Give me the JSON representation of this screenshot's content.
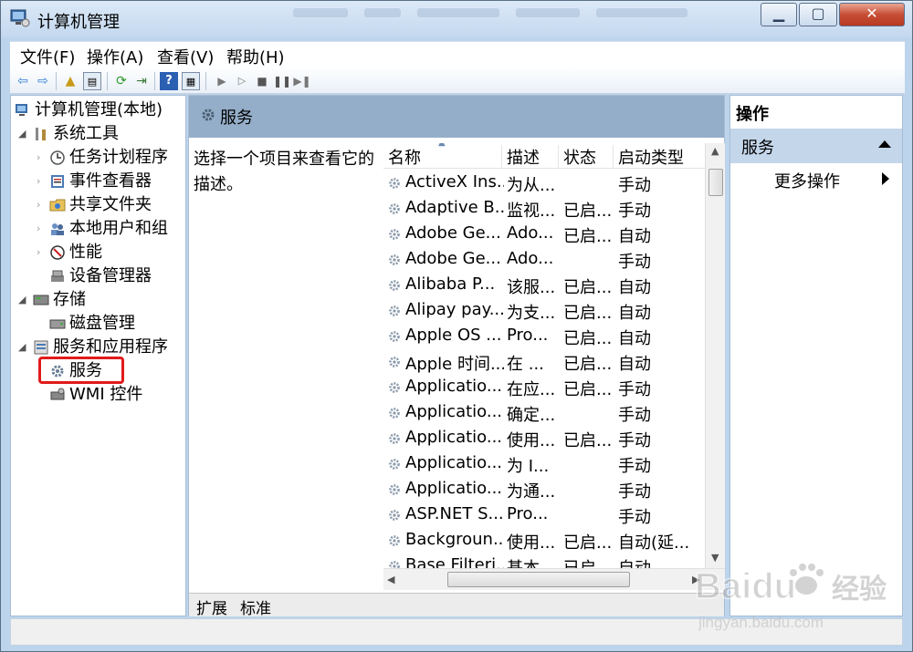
{
  "window": {
    "title": "计算机管理"
  },
  "menu": [
    "文件(F)",
    "操作(A)",
    "查看(V)",
    "帮助(H)"
  ],
  "tree": {
    "root": "计算机管理(本地)",
    "system_tools": "系统工具",
    "task_scheduler": "任务计划程序",
    "event_viewer": "事件查看器",
    "shared_folders": "共享文件夹",
    "local_users": "本地用户和组",
    "performance": "性能",
    "device_manager": "设备管理器",
    "storage": "存储",
    "disk_management": "磁盘管理",
    "services_apps": "服务和应用程序",
    "services": "服务",
    "wmi": "WMI 控件"
  },
  "center": {
    "header": "服务",
    "description": "选择一个项目来查看它的描述。",
    "columns": [
      "名称",
      "描述",
      "状态",
      "启动类型"
    ],
    "rows": [
      [
        "ActiveX Ins...",
        "为从...",
        "",
        "手动"
      ],
      [
        "Adaptive B...",
        "监视...",
        "已启...",
        "手动"
      ],
      [
        "Adobe Ge...",
        "Ado...",
        "已启...",
        "自动"
      ],
      [
        "Adobe Ge...",
        "Ado...",
        "",
        "手动"
      ],
      [
        "Alibaba P...",
        "该服...",
        "已启...",
        "自动"
      ],
      [
        "Alipay pay...",
        "为支...",
        "已启...",
        "自动"
      ],
      [
        "Apple OS ...",
        "Pro...",
        "已启...",
        "自动"
      ],
      [
        "Apple 时间...",
        "在 ...",
        "已启...",
        "自动"
      ],
      [
        "Applicatio...",
        "在应...",
        "已启...",
        "手动"
      ],
      [
        "Applicatio...",
        "确定...",
        "",
        "手动"
      ],
      [
        "Applicatio...",
        "使用...",
        "已启...",
        "手动"
      ],
      [
        "Applicatio...",
        "为 I...",
        "",
        "手动"
      ],
      [
        "Applicatio...",
        "为通...",
        "",
        "手动"
      ],
      [
        "ASP.NET S...",
        "Pro...",
        "",
        "手动"
      ],
      [
        "Backgroun...",
        "使用...",
        "已启...",
        "自动(延..."
      ],
      [
        "Base Filteri...",
        "基本...",
        "已启...",
        "自动"
      ]
    ],
    "tabs": [
      "扩展",
      "标准"
    ]
  },
  "actions": {
    "title": "操作",
    "section": "服务",
    "more": "更多操作"
  },
  "watermark": {
    "brand": "Baidu",
    "cn": "经验",
    "url": "jingyan.baidu.com"
  }
}
